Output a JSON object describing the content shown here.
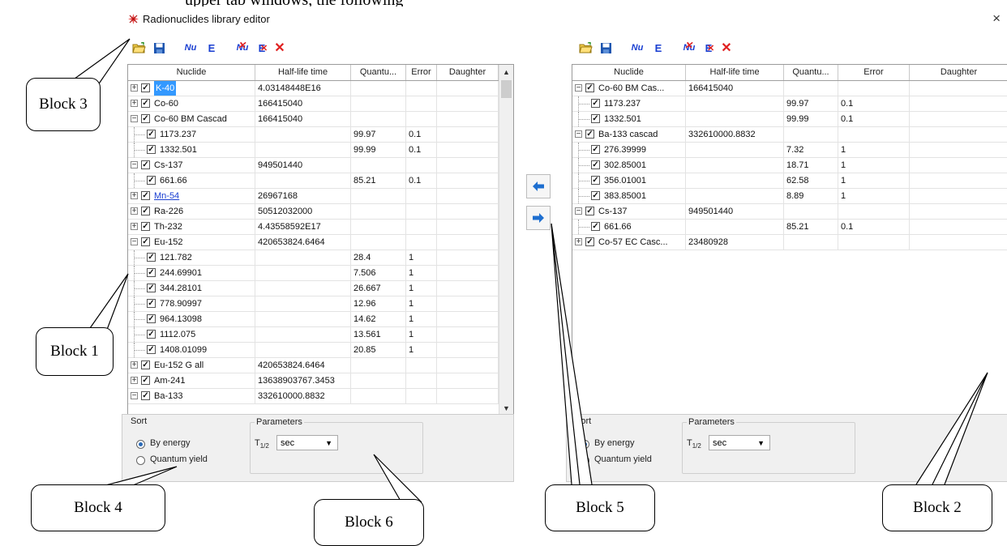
{
  "top_caption": "upper tab windows, the following",
  "window": {
    "title": "Radionuclides library editor",
    "close_glyph": "×",
    "icon": "radionuclide-app-icon"
  },
  "toolbar": {
    "open": "open-folder-icon",
    "save": "save-disk-icon",
    "nu": "Nu",
    "e": "E",
    "nu_del": "Nu",
    "e_del": "E",
    "del": "✕"
  },
  "columns": [
    "Nuclide",
    "Half-life time",
    "Quantu...",
    "Error",
    "Daughter"
  ],
  "left_rows": [
    {
      "level": 0,
      "expander": "+",
      "name": "K-40",
      "half": "4.03148448E16",
      "q": "",
      "err": "",
      "selected": true
    },
    {
      "level": 0,
      "expander": "+",
      "name": "Co-60",
      "half": "166415040",
      "q": "",
      "err": ""
    },
    {
      "level": 0,
      "expander": "−",
      "name": "Co-60 BM Cascad",
      "half": "166415040",
      "q": "",
      "err": ""
    },
    {
      "level": 1,
      "name": "1173.237",
      "half": "",
      "q": "99.97",
      "err": "0.1"
    },
    {
      "level": 1,
      "name": "1332.501",
      "half": "",
      "q": "99.99",
      "err": "0.1"
    },
    {
      "level": 0,
      "expander": "−",
      "name": "Cs-137",
      "half": "949501440",
      "q": "",
      "err": ""
    },
    {
      "level": 1,
      "name": "661.66",
      "half": "",
      "q": "85.21",
      "err": "0.1"
    },
    {
      "level": 0,
      "expander": "+",
      "name": "Mn-54",
      "half": "26967168",
      "q": "",
      "err": "",
      "link": true
    },
    {
      "level": 0,
      "expander": "+",
      "name": "Ra-226",
      "half": "50512032000",
      "q": "",
      "err": ""
    },
    {
      "level": 0,
      "expander": "+",
      "name": "Th-232",
      "half": "4.43558592E17",
      "q": "",
      "err": ""
    },
    {
      "level": 0,
      "expander": "−",
      "name": "Eu-152",
      "half": "420653824.6464",
      "q": "",
      "err": ""
    },
    {
      "level": 1,
      "name": "121.782",
      "half": "",
      "q": "28.4",
      "err": "1"
    },
    {
      "level": 1,
      "name": "244.69901",
      "half": "",
      "q": "7.506",
      "err": "1"
    },
    {
      "level": 1,
      "name": "344.28101",
      "half": "",
      "q": "26.667",
      "err": "1"
    },
    {
      "level": 1,
      "name": "778.90997",
      "half": "",
      "q": "12.96",
      "err": "1"
    },
    {
      "level": 1,
      "name": "964.13098",
      "half": "",
      "q": "14.62",
      "err": "1"
    },
    {
      "level": 1,
      "name": "1112.075",
      "half": "",
      "q": "13.561",
      "err": "1"
    },
    {
      "level": 1,
      "name": "1408.01099",
      "half": "",
      "q": "20.85",
      "err": "1"
    },
    {
      "level": 0,
      "expander": "+",
      "name": "Eu-152 G all",
      "half": "420653824.6464",
      "q": "",
      "err": ""
    },
    {
      "level": 0,
      "expander": "+",
      "name": "Am-241",
      "half": "13638903767.3453",
      "q": "",
      "err": ""
    },
    {
      "level": 0,
      "expander": "−",
      "name": "Ba-133",
      "half": "332610000.8832",
      "q": "",
      "err": ""
    }
  ],
  "right_rows": [
    {
      "level": 0,
      "expander": "−",
      "name": "Co-60 BM Cas...",
      "half": "166415040",
      "q": "",
      "err": ""
    },
    {
      "level": 1,
      "name": "1173.237",
      "half": "",
      "q": "99.97",
      "err": "0.1"
    },
    {
      "level": 1,
      "name": "1332.501",
      "half": "",
      "q": "99.99",
      "err": "0.1"
    },
    {
      "level": 0,
      "expander": "−",
      "name": "Ba-133 cascad",
      "half": "332610000.8832",
      "q": "",
      "err": ""
    },
    {
      "level": 1,
      "name": "276.39999",
      "half": "",
      "q": "7.32",
      "err": "1"
    },
    {
      "level": 1,
      "name": "302.85001",
      "half": "",
      "q": "18.71",
      "err": "1"
    },
    {
      "level": 1,
      "name": "356.01001",
      "half": "",
      "q": "62.58",
      "err": "1"
    },
    {
      "level": 1,
      "name": "383.85001",
      "half": "",
      "q": "8.89",
      "err": "1"
    },
    {
      "level": 0,
      "expander": "−",
      "name": "Cs-137",
      "half": "949501440",
      "q": "",
      "err": ""
    },
    {
      "level": 1,
      "name": "661.66",
      "half": "",
      "q": "85.21",
      "err": "0.1"
    },
    {
      "level": 0,
      "expander": "+",
      "name": "Co-57 EC Casc...",
      "half": "23480928",
      "q": "",
      "err": ""
    }
  ],
  "sort": {
    "title": "Sort",
    "by_energy": "By energy",
    "quantum_yield": "Quantum yield",
    "selected": "By energy"
  },
  "params": {
    "title": "Parameters",
    "t_main": "T",
    "t_sub": "1/2",
    "unit": "sec"
  },
  "callouts": {
    "b1": "Block 1",
    "b2": "Block 2",
    "b3": "Block 3",
    "b4": "Block 4",
    "b5": "Block 5",
    "b6": "Block 6"
  },
  "colors": {
    "selection": "#3399ff",
    "arrow": "#1e6fd0",
    "delete": "#e02020",
    "nu_blue": "#1a3fd1"
  }
}
